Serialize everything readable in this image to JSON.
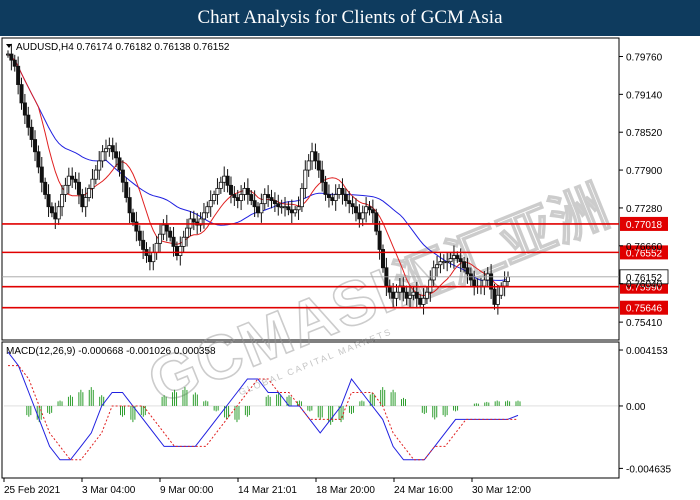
{
  "banner": {
    "title": "Chart Analysis for Clients of GCM Asia",
    "background": "#0e3b5e"
  },
  "watermark": {
    "text": "GCMASIA",
    "chinese": "汇汇亚洲",
    "small": "GLOBAL CAPITAL MARKETS"
  },
  "chart_data": {
    "type": "candlestick",
    "price": {
      "header": "AUDUSD,H4  0.76174  0.76182  0.76138  0.76152",
      "yticks": [
        "0.79760",
        "0.79140",
        "0.78520",
        "0.77900",
        "0.77280",
        "0.76660",
        "0.76040",
        "0.75410"
      ],
      "ylim": [
        0.7515,
        0.8003
      ],
      "close_start": 0.798,
      "close_path": [
        0.798,
        0.796,
        0.79,
        0.786,
        0.782,
        0.777,
        0.773,
        0.771,
        0.775,
        0.778,
        0.777,
        0.773,
        0.776,
        0.779,
        0.782,
        0.783,
        0.781,
        0.777,
        0.772,
        0.769,
        0.766,
        0.764,
        0.767,
        0.77,
        0.768,
        0.765,
        0.768,
        0.771,
        0.77,
        0.772,
        0.774,
        0.776,
        0.778,
        0.775,
        0.774,
        0.776,
        0.774,
        0.772,
        0.775,
        0.774,
        0.773,
        0.773,
        0.772,
        0.773,
        0.779,
        0.782,
        0.779,
        0.775,
        0.774,
        0.776,
        0.774,
        0.773,
        0.771,
        0.773,
        0.772,
        0.766,
        0.76,
        0.758,
        0.76,
        0.758,
        0.759,
        0.757,
        0.759,
        0.763,
        0.764,
        0.764,
        0.765,
        0.764,
        0.762,
        0.76,
        0.76,
        0.762,
        0.757,
        0.76,
        0.7615
      ],
      "current_price": "0.76152",
      "levels": [
        {
          "label": "0.77018",
          "value": 0.77018
        },
        {
          "label": "0.76552",
          "value": 0.76552
        },
        {
          "label": "0.75990",
          "value": 0.7599
        },
        {
          "label": "0.75646",
          "value": 0.75646
        }
      ],
      "series": [
        {
          "role": "candles",
          "up_color": "#111111",
          "down_color": "#111111"
        },
        {
          "role": "ma-fast",
          "color": "#e02020"
        },
        {
          "role": "ma-slow",
          "color": "#2020e0"
        }
      ]
    },
    "macd": {
      "label": "MACD(12,26,9) -0.000668 -0.001026 0.000358",
      "yticks": [
        "0.004153",
        "0.00",
        "-0.004635"
      ],
      "ylim": [
        -0.0052,
        0.0046
      ],
      "macd_line": [
        0.004,
        0.003,
        0.001,
        -0.001,
        -0.003,
        -0.004,
        -0.004,
        -0.003,
        -0.002,
        0.0,
        0.001,
        0.001,
        0.0,
        -0.001,
        -0.002,
        -0.003,
        -0.003,
        -0.003,
        -0.003,
        -0.002,
        -0.001,
        0.0,
        0.001,
        0.002,
        0.002,
        0.001,
        0.001,
        0.0,
        0.0,
        -0.001,
        -0.002,
        -0.001,
        0.0,
        0.002,
        0.001,
        0.0,
        -0.001,
        -0.003,
        -0.004,
        -0.004,
        -0.004,
        -0.003,
        -0.002,
        -0.001,
        -0.001,
        -0.001,
        -0.001,
        -0.001,
        -0.001,
        -0.0007
      ],
      "signal_line": [
        0.003,
        0.003,
        0.002,
        0.0,
        -0.002,
        -0.003,
        -0.004,
        -0.004,
        -0.003,
        -0.002,
        0.0,
        0.0,
        0.0,
        0.0,
        -0.001,
        -0.002,
        -0.003,
        -0.003,
        -0.003,
        -0.003,
        -0.002,
        -0.001,
        0.0,
        0.001,
        0.002,
        0.002,
        0.001,
        0.001,
        0.0,
        -0.001,
        -0.001,
        -0.001,
        -0.001,
        0.001,
        0.001,
        0.001,
        0.0,
        -0.002,
        -0.003,
        -0.004,
        -0.004,
        -0.003,
        -0.003,
        -0.002,
        -0.001,
        -0.001,
        -0.001,
        -0.001,
        -0.001,
        -0.001
      ],
      "histogram": [
        0.0,
        0.0,
        -0.0008,
        -0.0012,
        -0.0006,
        0.0004,
        0.0008,
        0.0012,
        0.0014,
        0.0008,
        0.0,
        -0.0008,
        -0.0012,
        -0.0008,
        0.0,
        0.0008,
        0.0012,
        0.0014,
        0.001,
        0.0004,
        -0.0004,
        -0.001,
        -0.0012,
        -0.0008,
        0.0,
        0.0008,
        0.001,
        0.0008,
        0.0004,
        -0.0004,
        -0.001,
        -0.0014,
        -0.0012,
        -0.0006,
        0.0004,
        0.001,
        0.0014,
        0.0012,
        0.0006,
        0.0,
        -0.0006,
        -0.001,
        -0.0008,
        -0.0004,
        0.0,
        0.0002,
        0.0003,
        0.0004,
        0.0004,
        0.0004
      ],
      "macd_color": "#2020e0",
      "signal_color": "#e02020",
      "hist_color": "#2e9e2e"
    },
    "x_ticks": [
      "25 Feb 2021",
      "3 Mar 04:00",
      "9 Mar 00:00",
      "14 Mar 21:01",
      "18 Mar 20:00",
      "24 Mar 16:00",
      "30 Mar 12:00"
    ]
  }
}
